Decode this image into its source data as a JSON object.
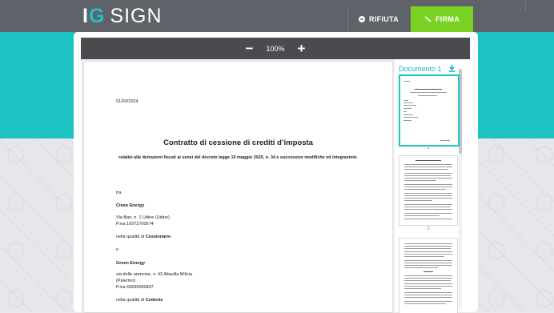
{
  "brand": {
    "logo_ig_i": "I",
    "logo_ig_g": "G",
    "logo_sign": "SIGN"
  },
  "header": {
    "reject_label": "RIFIUTA",
    "sign_label": "FIRMA"
  },
  "toolbar": {
    "zoom_out": "−",
    "zoom_level": "100%",
    "zoom_in": "+"
  },
  "document": {
    "date": "01/02/2024",
    "title": "Contratto di cessione di crediti d’imposta",
    "subtitle": "relativi alle detrazioni fiscali ai sensi del decreto legge 19 maggio 2020, n. 34 e successive modifiche ed integrazioni.",
    "tra": "tra",
    "party1_name": "Clean Energy",
    "party1_address": "Via Bari, n. 1 Udine (Udine)",
    "party1_vat": "P.iva 16972700674",
    "party1_role_prefix": "nella qualità di ",
    "party1_role": "Cessionario",
    "e": "e",
    "party2_name": "Green Energy",
    "party2_address": "via delle arancine, n. 43 Altavilla Milicia",
    "party2_city": "(Palermo)",
    "party2_vat": "P.iva 65835090807",
    "party2_role_prefix": "nella qualità di ",
    "party2_role": "Cedente"
  },
  "sidebar": {
    "doc_label": "Documento 1",
    "thumbnails": [
      {
        "number": "1"
      },
      {
        "number": "2"
      }
    ]
  },
  "colors": {
    "teal": "#1cc3c3",
    "green": "#7bd224",
    "dark": "#5f6268"
  }
}
